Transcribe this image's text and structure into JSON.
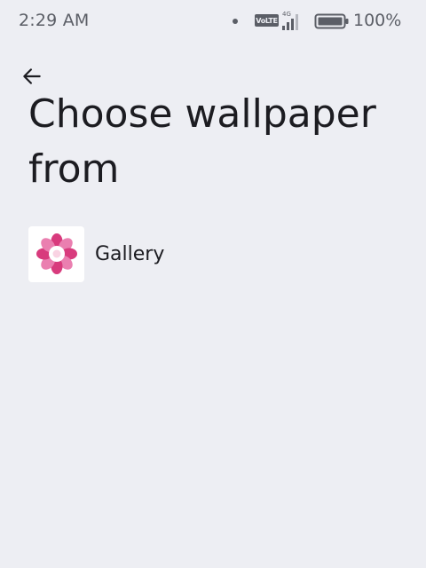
{
  "status_bar": {
    "time": "2:29 AM",
    "volte": "VoLTE",
    "network": "4G",
    "battery_percent": "100%"
  },
  "header": {
    "title": "Choose wallpaper from"
  },
  "sources": [
    {
      "label": "Gallery",
      "icon": "gallery-flower-icon"
    }
  ],
  "colors": {
    "background": "#edeef3",
    "text_primary": "#1c1c21",
    "status_text": "#5b5e66",
    "flower_dark": "#d83b7d",
    "flower_light": "#ea7fb0",
    "flower_center": "#f9d3e3"
  }
}
